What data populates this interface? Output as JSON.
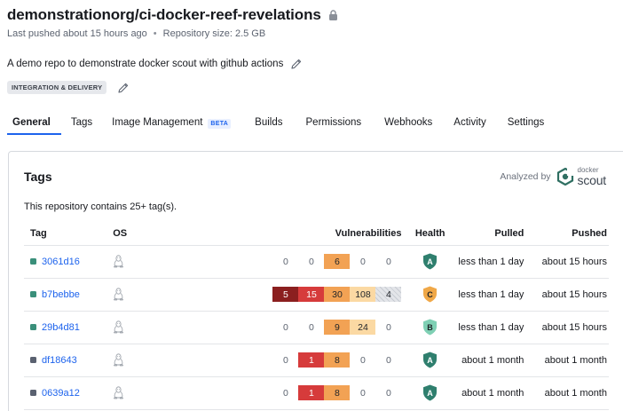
{
  "repo": {
    "title": "demonstrationorg/ci-docker-reef-revelations",
    "last_pushed": "Last pushed about 15 hours ago",
    "separator": "•",
    "size": "Repository size: 2.5 GB",
    "description": "A demo repo to demonstrate docker scout with github actions",
    "category": "INTEGRATION & DELIVERY"
  },
  "tabs": [
    {
      "label": "General",
      "active": true
    },
    {
      "label": "Tags"
    },
    {
      "label": "Image Management",
      "badge": "BETA"
    },
    {
      "label": "Builds"
    },
    {
      "label": "Permissions"
    },
    {
      "label": "Webhooks"
    },
    {
      "label": "Activity"
    },
    {
      "label": "Settings"
    }
  ],
  "tags_card": {
    "title": "Tags",
    "analyzed_by": "Analyzed by",
    "scout_small": "docker",
    "scout_big": "scout",
    "summary": "This repository contains 25+ tag(s).",
    "columns": {
      "tag": "Tag",
      "os": "OS",
      "vulnerabilities": "Vulnerabilities",
      "health": "Health",
      "pulled": "Pulled",
      "pushed": "Pushed"
    },
    "rows": [
      {
        "tag": "3061d16",
        "square_color": "#3a8f7a",
        "os": "linux-icon",
        "vulns": [
          "0",
          "0",
          "6",
          "0",
          "0"
        ],
        "vuln_styles": [
          "plain",
          "plain",
          "med",
          "plain",
          "plain"
        ],
        "health": "A",
        "health_color": "#2f7f6e",
        "pulled": "less than 1 day",
        "pushed": "about 15 hours"
      },
      {
        "tag": "b7bebbe",
        "square_color": "#3a8f7a",
        "os": "linux-icon",
        "vulns": [
          "5",
          "15",
          "30",
          "108",
          "4"
        ],
        "vuln_styles": [
          "crit",
          "high",
          "med",
          "low",
          "unk"
        ],
        "health": "C",
        "health_color": "#f0a848",
        "pulled": "less than 1 day",
        "pushed": "about 15 hours"
      },
      {
        "tag": "29b4d81",
        "square_color": "#3a8f7a",
        "os": "linux-icon",
        "vulns": [
          "0",
          "0",
          "9",
          "24",
          "0"
        ],
        "vuln_styles": [
          "plain",
          "plain",
          "med",
          "low",
          "plain"
        ],
        "health": "B",
        "health_color": "#7fd0b4",
        "pulled": "less than 1 day",
        "pushed": "about 15 hours"
      },
      {
        "tag": "df18643",
        "square_color": "#5a6170",
        "os": "linux-icon",
        "vulns": [
          "0",
          "1",
          "8",
          "0",
          "0"
        ],
        "vuln_styles": [
          "plain",
          "high",
          "med",
          "plain",
          "plain"
        ],
        "health": "A",
        "health_color": "#2f7f6e",
        "pulled": "about 1 month",
        "pushed": "about 1 month"
      },
      {
        "tag": "0639a12",
        "square_color": "#5a6170",
        "os": "linux-icon",
        "vulns": [
          "0",
          "1",
          "8",
          "0",
          "0"
        ],
        "vuln_styles": [
          "plain",
          "high",
          "med",
          "plain",
          "plain"
        ],
        "health": "A",
        "health_color": "#2f7f6e",
        "pulled": "about 1 month",
        "pushed": "about 1 month"
      }
    ]
  },
  "colors": {
    "accent": "#1d63ed",
    "critical": "#8b1f1f",
    "high": "#d63b3b",
    "medium": "#f2a254",
    "low": "#fbd9a3"
  }
}
